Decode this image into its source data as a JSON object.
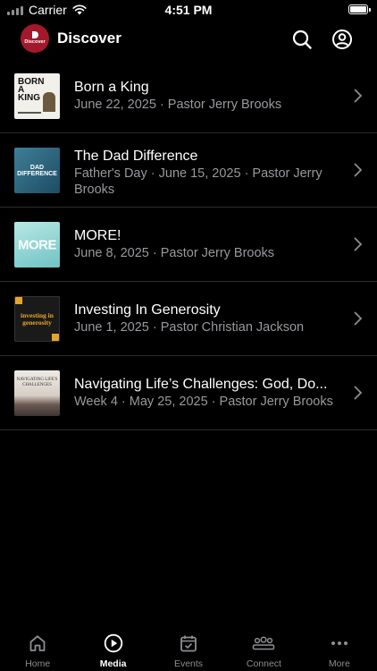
{
  "status_bar": {
    "carrier": "Carrier",
    "time": "4:51 PM"
  },
  "header": {
    "title": "Discover",
    "logo_text": "Discover"
  },
  "items": [
    {
      "title": "Born a King",
      "subtitle": "June 22, 2025 · Pastor Jerry Brooks",
      "thumb_text": "BORN A KING"
    },
    {
      "title": "The Dad Difference",
      "subtitle": "Father's Day · June 15, 2025 · Pastor Jerry Brooks",
      "thumb_text": "DAD DIFFERENCE"
    },
    {
      "title": "MORE!",
      "subtitle": "June 8, 2025 · Pastor Jerry Brooks",
      "thumb_text": "MORE"
    },
    {
      "title": "Investing In Generosity",
      "subtitle": "June 1, 2025 · Pastor Christian Jackson",
      "thumb_text": "investing in generosity"
    },
    {
      "title": "Navigating Life’s Challenges: God, Do...",
      "subtitle": "Week 4 · May 25, 2025 · Pastor Jerry Brooks",
      "thumb_text": "NAVIGATING LIFE'S CHALLENGES"
    }
  ],
  "tabs": [
    {
      "label": "Home",
      "icon": "home-icon"
    },
    {
      "label": "Media",
      "icon": "play-circle-icon"
    },
    {
      "label": "Events",
      "icon": "calendar-icon"
    },
    {
      "label": "Connect",
      "icon": "people-icon"
    },
    {
      "label": "More",
      "icon": "ellipsis-icon"
    }
  ],
  "active_tab": "Media",
  "colors": {
    "background": "#000000",
    "subtitle": "#98989e",
    "logo": "#a3192c",
    "tab_inactive": "#8e8e93"
  }
}
